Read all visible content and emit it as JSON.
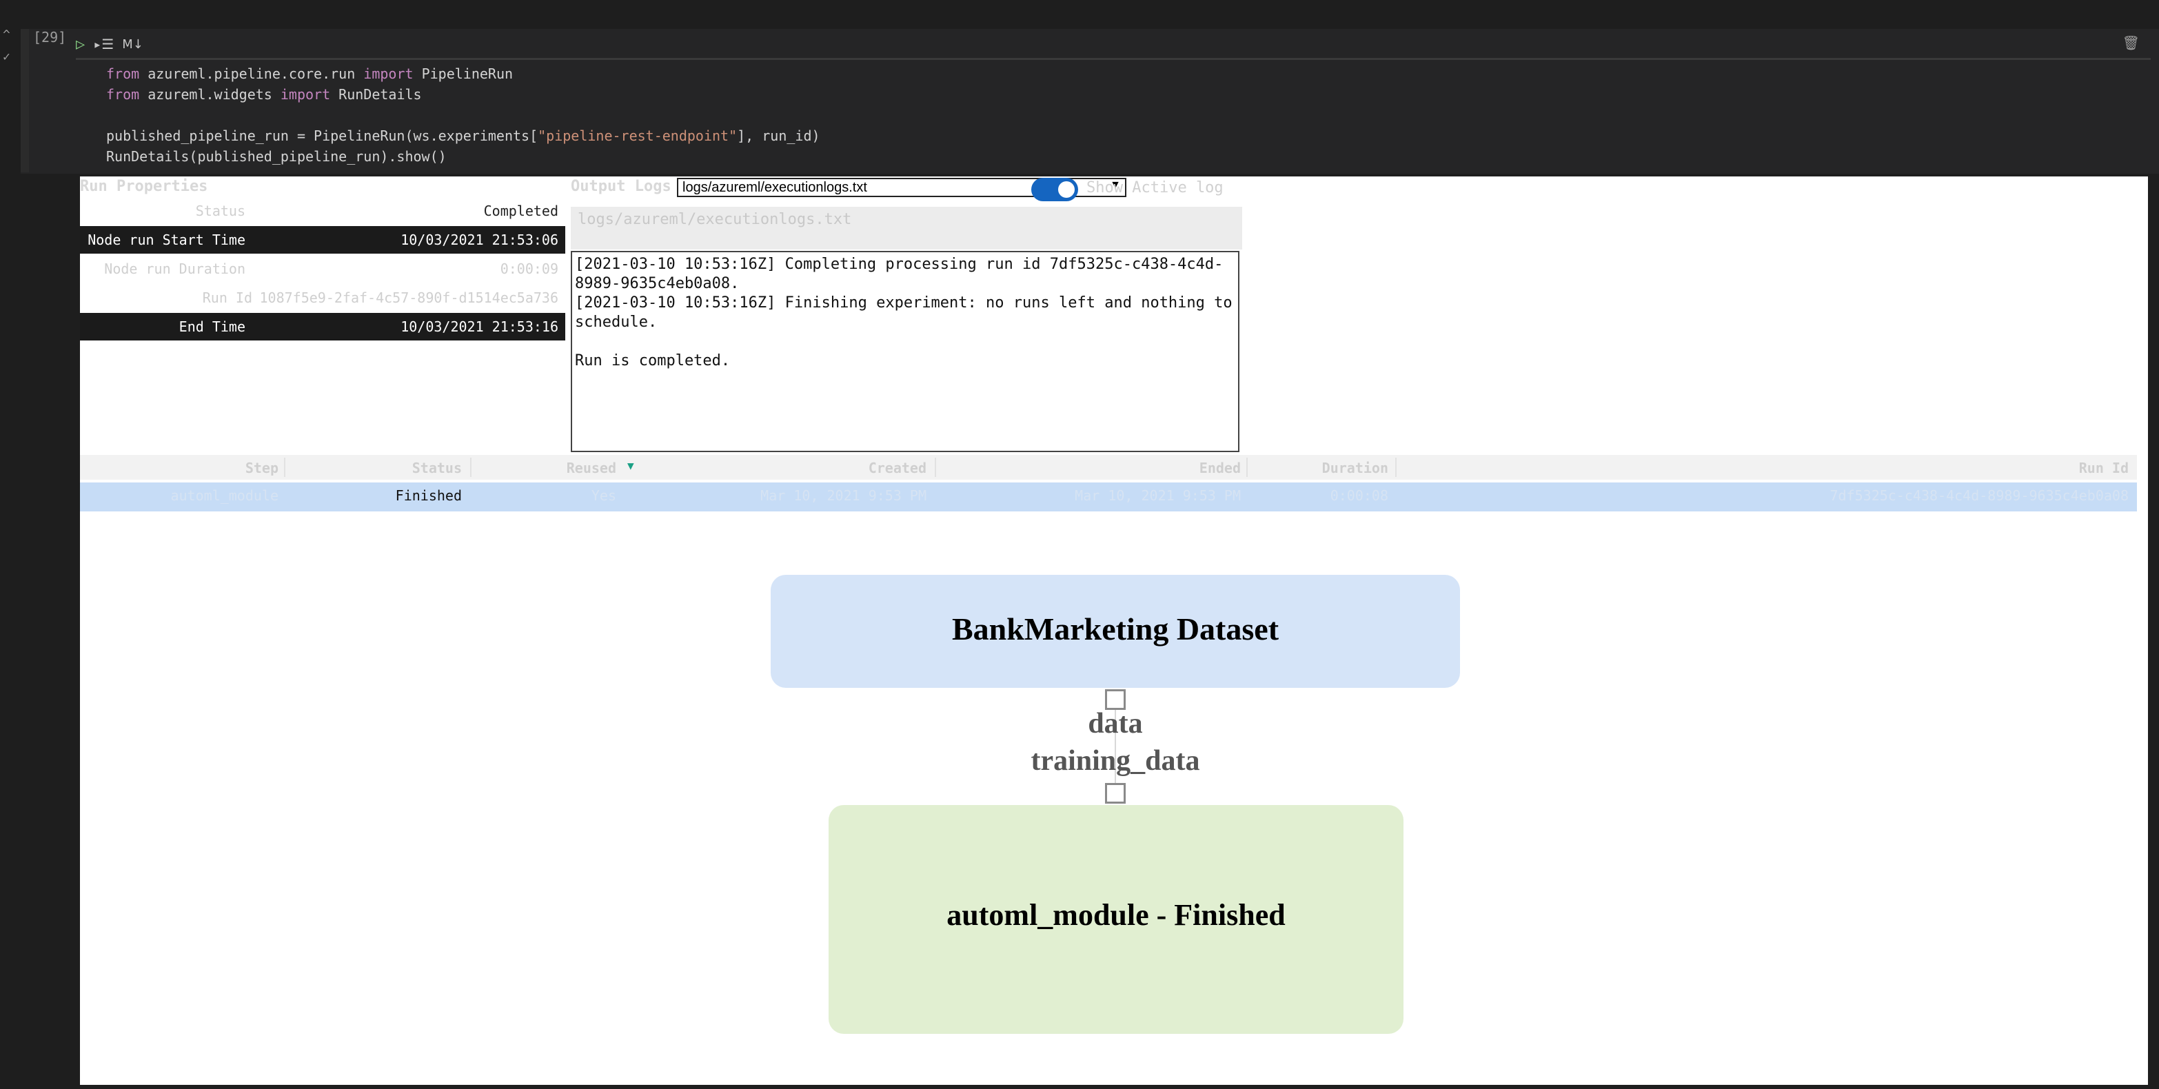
{
  "cell": {
    "number": "[29]",
    "md_label": "M↓",
    "code_lines": [
      {
        "parts": [
          {
            "kw": "from"
          },
          {
            "t": " azureml.pipeline.core.run "
          },
          {
            "kw": "import"
          },
          {
            "t": " PipelineRun"
          }
        ]
      },
      {
        "parts": [
          {
            "kw": "from"
          },
          {
            "t": " azureml.widgets "
          },
          {
            "kw": "import"
          },
          {
            "t": " RunDetails"
          }
        ]
      },
      {
        "parts": []
      },
      {
        "parts": [
          {
            "t": "published_pipeline_run = PipelineRun(ws.experiments["
          },
          {
            "str": "\"pipeline-rest-endpoint\""
          },
          {
            "t": "], run_id)"
          }
        ]
      },
      {
        "parts": [
          {
            "t": "RunDetails(published_pipeline_run).show()"
          }
        ]
      }
    ]
  },
  "run_properties": {
    "title": "Run Properties",
    "rows": [
      {
        "key": "Status",
        "value": "Completed"
      },
      {
        "key": "Node run Start Time",
        "value": "10/03/2021 21:53:06"
      },
      {
        "key": "Node run Duration",
        "value": "0:00:09"
      },
      {
        "key": "Run Id",
        "value": "1087f5e9-2faf-4c57-890f-d1514ec5a736"
      },
      {
        "key": "End Time",
        "value": "10/03/2021 21:53:16"
      }
    ]
  },
  "output_logs": {
    "title": "Output Logs",
    "selected_log": "logs/azureml/executionlogs.txt",
    "toggle_label": "Show Active log",
    "toggle_on": true,
    "log_path": "logs/azureml/executionlogs.txt",
    "log_text": "[2021-03-10 10:53:16Z] Completing processing run id 7df5325c-c438-4c4d-8989-9635c4eb0a08.\n[2021-03-10 10:53:16Z] Finishing experiment: no runs left and nothing to schedule.\n\nRun is completed."
  },
  "steps_table": {
    "headers": {
      "step": "Step",
      "status": "Status",
      "reused": "Reused",
      "created": "Created",
      "ended": "Ended",
      "duration": "Duration",
      "run_id": "Run Id"
    },
    "row": {
      "step": "automl_module",
      "status": "Finished",
      "reused": "Yes",
      "created": "Mar 10, 2021 9:53 PM",
      "ended": "Mar 10, 2021 9:53 PM",
      "duration": "0:00:08",
      "run_id": "7df5325c-c438-4c4d-8989-9635c4eb0a08"
    }
  },
  "graph": {
    "top_node": "BankMarketing Dataset",
    "edge_label_top": "data",
    "edge_label_bottom": "training_data",
    "bottom_node": "automl_module - Finished",
    "colors": {
      "top_node": "#d5e4f8",
      "bottom_node": "#e1efd1"
    }
  },
  "colors": {
    "accent_toggle": "#1565c0",
    "selected_row": "#c6dcf6",
    "keyword": "#c586c0",
    "string": "#ce9178"
  }
}
